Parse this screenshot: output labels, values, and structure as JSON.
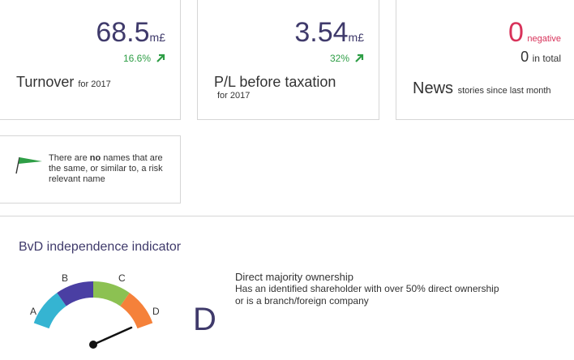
{
  "turnover": {
    "value": "68.5",
    "unit": "m£",
    "change": "16.6%",
    "label": "Turnover",
    "sublabel": "for 2017"
  },
  "pl": {
    "value": "3.54",
    "unit": "m£",
    "change": "32%",
    "label": "P/L before taxation",
    "sublabel": "for 2017"
  },
  "news": {
    "negative_count": "0",
    "negative_label": "negative",
    "total_count": "0",
    "total_label": "in total",
    "label": "News",
    "sublabel": "stories since last month"
  },
  "names": {
    "text_before": "There are ",
    "text_bold": "no",
    "text_after": " names that are the same, or similar to, a risk relevant name"
  },
  "independence": {
    "title": "BvD independence indicator",
    "grade": "D",
    "gauge_labels": [
      "A",
      "B",
      "C",
      "D"
    ],
    "gauge_colors": [
      "#35b4d2",
      "#4a3fa3",
      "#8cc152",
      "#f5813a"
    ],
    "description_title": "Direct majority ownership",
    "description_line1": "Has an identified shareholder with over 50% direct ownership",
    "description_line2": "or is a branch/foreign company"
  },
  "colors": {
    "accent": "#3f3a6b",
    "positive": "#2e9e46",
    "negative": "#d8325a",
    "flag": "#2e9e46"
  }
}
